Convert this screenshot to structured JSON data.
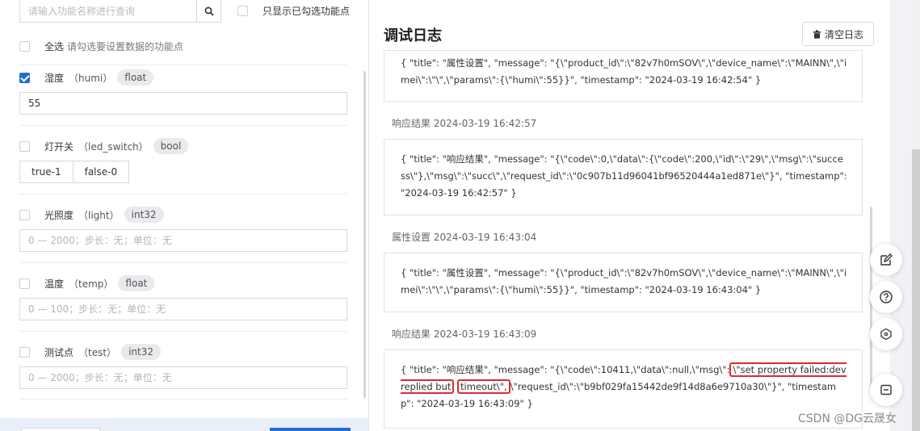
{
  "search": {
    "placeholder": "请输入功能名称进行查询"
  },
  "filter": {
    "only_checked_label": "只显示已勾选功能点"
  },
  "select_all": {
    "label": "全选",
    "hint": "请勾选要设置数据的功能点"
  },
  "items": [
    {
      "name": "湿度",
      "id": "（humi）",
      "type": "float",
      "checked": true,
      "value": "55",
      "placeholder": ""
    },
    {
      "name": "灯开关",
      "id": "（led_switch）",
      "type": "bool",
      "checked": false,
      "options": [
        "true-1",
        "false-0"
      ]
    },
    {
      "name": "光照度",
      "id": "（light）",
      "type": "int32",
      "checked": false,
      "value": "",
      "placeholder": "0 — 2000；步长：无；单位：无"
    },
    {
      "name": "温度",
      "id": "（temp）",
      "type": "float",
      "checked": false,
      "value": "",
      "placeholder": "0 — 100；步长：无；单位：无"
    },
    {
      "name": "测试点",
      "id": "（test）",
      "type": "int32",
      "checked": false,
      "value": "",
      "placeholder": "0 — 2000；步长：无；单位：无"
    }
  ],
  "log": {
    "title": "调试日志",
    "clear_label": "清空日志",
    "entries": [
      {
        "header": "",
        "body": "{ \"title\": \"属性设置\", \"message\": \"{\\\"product_id\\\":\\\"82v7h0mSOV\\\",\\\"device_name\\\":\\\"MAINN\\\",\\\"imei\\\":\\\"\\\",\\\"params\\\":{\\\"humi\\\":55}}\", \"timestamp\": \"2024-03-19 16:42:54\" }"
      },
      {
        "header": "响应结果 2024-03-19 16:42:57",
        "body": "{ \"title\": \"响应结果\", \"message\": \"{\\\"code\\\":0,\\\"data\\\":{\\\"code\\\":200,\\\"id\\\":\\\"29\\\",\\\"msg\\\":\\\"success\\\"},\\\"msg\\\":\\\"succ\\\",\\\"request_id\\\":\\\"0c907b11d96041bf96520444a1ed871e\\\"}\", \"timestamp\": \"2024-03-19 16:42:57\" }"
      },
      {
        "header": "属性设置 2024-03-19 16:43:04",
        "body": "{ \"title\": \"属性设置\", \"message\": \"{\\\"product_id\\\":\\\"82v7h0mSOV\\\",\\\"device_name\\\":\\\"MAINN\\\",\\\"imei\\\":\\\"\\\",\\\"params\\\":{\\\"humi\\\":55}}\", \"timestamp\": \"2024-03-19 16:43:04\" }"
      },
      {
        "header": "响应结果 2024-03-19 16:43:09",
        "body_pre": "{ \"title\": \"响应结果\", \"message\": \"{\\\"code\\\":10411,\\\"data\\\":null,\\\"msg\\\":",
        "body_hl1": "\\\"set property failed:dev replied but",
        "body_hl2": "timeout\\\",",
        "body_post": "\\\"request_id\\\":\\\"b9bf029fa15442de9f14d8a6e9710a30\\\"}\", \"timestamp\": \"2024-03-19 16:43:09\" }"
      }
    ]
  },
  "watermark": "CSDN @DG云晟女",
  "icons": {
    "search": "search-icon",
    "trash": "trash-icon",
    "edit": "edit-icon",
    "help": "help-icon",
    "share": "share-icon",
    "collapse": "collapse-icon"
  },
  "colors": {
    "primary": "#1f6ed4",
    "highlight": "#e0292b"
  }
}
